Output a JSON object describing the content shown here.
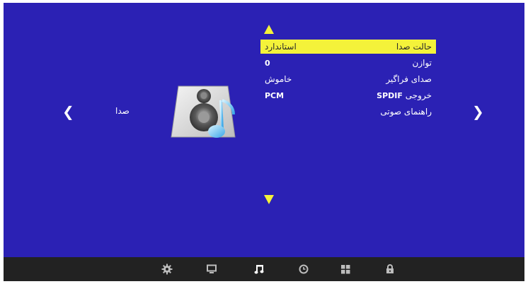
{
  "section": {
    "label": "صدا"
  },
  "menu": {
    "items": [
      {
        "label": "حالت صدا",
        "value": "استاندارد",
        "selected": true
      },
      {
        "label": "توازن",
        "value": "0",
        "selected": false
      },
      {
        "label": "صدای فراگیر",
        "value": "خاموش",
        "selected": false
      },
      {
        "label_prefix": "خروجی",
        "label_latin": "SPDIF",
        "value": "PCM",
        "selected": false
      },
      {
        "label": "راهنمای صوتی",
        "value": "",
        "selected": false
      }
    ]
  },
  "nav": {
    "left": "❮",
    "right": "❯"
  },
  "tabs": [
    {
      "icon": "gear-icon",
      "active": false
    },
    {
      "icon": "monitor-icon",
      "active": false
    },
    {
      "icon": "music-note-icon",
      "active": true
    },
    {
      "icon": "clock-icon",
      "active": false
    },
    {
      "icon": "grid-icon",
      "active": false
    },
    {
      "icon": "lock-icon",
      "active": false
    }
  ],
  "colors": {
    "background": "#2b21b4",
    "highlight": "#f4f23a",
    "bottom_bar": "#222222",
    "text": "#ffffff"
  }
}
